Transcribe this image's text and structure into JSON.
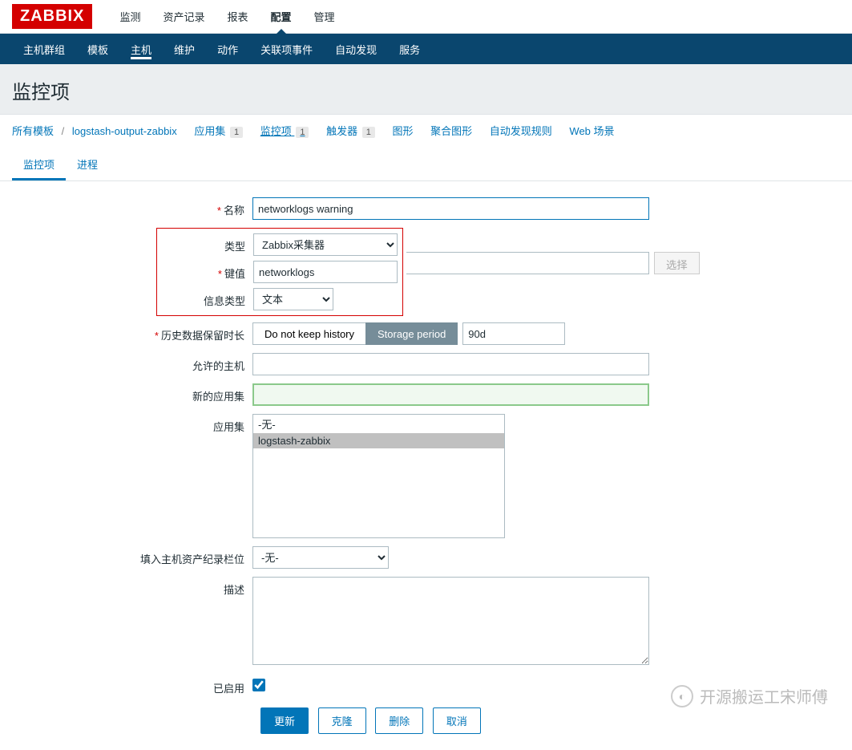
{
  "logo": "ZABBIX",
  "topNav": {
    "items": [
      "监测",
      "资产记录",
      "报表",
      "配置",
      "管理"
    ],
    "activeIndex": 3
  },
  "subNav": {
    "items": [
      "主机群组",
      "模板",
      "主机",
      "维护",
      "动作",
      "关联项事件",
      "自动发现",
      "服务"
    ],
    "activeIndex": 2
  },
  "pageTitle": "监控项",
  "breadcrumb": {
    "allTemplates": "所有模板",
    "template": "logstash-output-zabbix",
    "tags": [
      {
        "label": "应用集",
        "count": "1"
      },
      {
        "label": "监控项",
        "count": "1",
        "active": true
      },
      {
        "label": "触发器",
        "count": "1"
      },
      {
        "label": "图形",
        "count": ""
      },
      {
        "label": "聚合图形",
        "count": ""
      },
      {
        "label": "自动发现规则",
        "count": ""
      },
      {
        "label": "Web 场景",
        "count": ""
      }
    ]
  },
  "tabs": {
    "items": [
      "监控项",
      "进程"
    ],
    "activeIndex": 0
  },
  "form": {
    "labels": {
      "name": "名称",
      "type": "类型",
      "key": "键值",
      "infoType": "信息类型",
      "history": "历史数据保留时长",
      "allowedHosts": "允许的主机",
      "newApp": "新的应用集",
      "apps": "应用集",
      "inventory": "填入主机资产纪录栏位",
      "description": "描述",
      "enabled": "已启用"
    },
    "values": {
      "name": "networklogs warning",
      "type": "Zabbix采集器",
      "key": "networklogs",
      "infoType": "文本",
      "historyBtn1": "Do not keep history",
      "historyBtn2": "Storage period",
      "historyPeriod": "90d",
      "allowedHosts": "",
      "newApp": "",
      "appOptions": [
        "-无-",
        "logstash-zabbix"
      ],
      "inventory": "-无-",
      "description": "",
      "enabled": true
    },
    "selectBtn": "选择"
  },
  "actions": {
    "update": "更新",
    "clone": "克隆",
    "delete": "删除",
    "cancel": "取消"
  },
  "watermark": "开源搬运工宋师傅"
}
